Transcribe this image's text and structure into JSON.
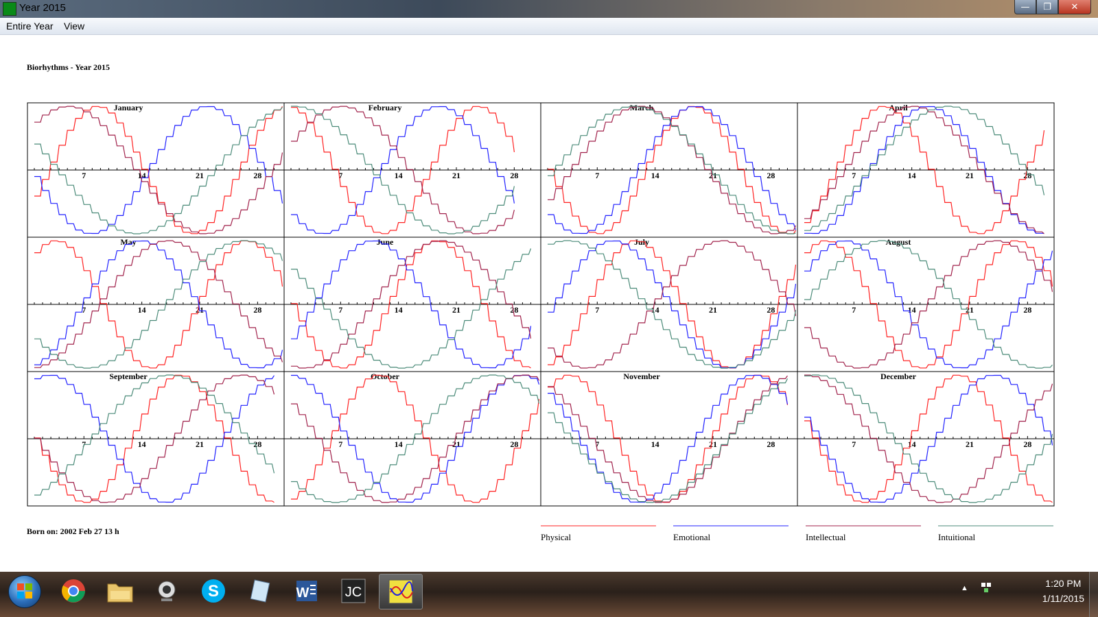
{
  "window": {
    "title": "Year 2015"
  },
  "menu": {
    "items": [
      "Entire Year",
      "View"
    ]
  },
  "page": {
    "heading": "Biorhythms - Year 2015",
    "born": "Born on: 2002 Feb 27  13 h"
  },
  "colors": {
    "physical": "#ff2020",
    "emotional": "#2020ff",
    "intellectual": "#a0204a",
    "intuitional": "#4a8a78"
  },
  "chart_data": {
    "type": "line",
    "title": "Biorhythms - Year 2015",
    "year": 2015,
    "months": [
      {
        "name": "January",
        "days": 31
      },
      {
        "name": "February",
        "days": 28
      },
      {
        "name": "March",
        "days": 31
      },
      {
        "name": "April",
        "days": 30
      },
      {
        "name": "May",
        "days": 31
      },
      {
        "name": "June",
        "days": 30
      },
      {
        "name": "July",
        "days": 31
      },
      {
        "name": "August",
        "days": 31
      },
      {
        "name": "September",
        "days": 30
      },
      {
        "name": "October",
        "days": 31
      },
      {
        "name": "November",
        "days": 30
      },
      {
        "name": "December",
        "days": 31
      }
    ],
    "x_tick_labels": [
      "7",
      "14",
      "21",
      "28"
    ],
    "ylim": [
      -1,
      1
    ],
    "birth": "2002-02-27 13:00",
    "series": [
      {
        "name": "Physical",
        "period_days": 23,
        "color": "#ff2020"
      },
      {
        "name": "Emotional",
        "period_days": 28,
        "color": "#2020ff"
      },
      {
        "name": "Intellectual",
        "period_days": 33,
        "color": "#a0204a"
      },
      {
        "name": "Intuitional",
        "period_days": 38,
        "color": "#4a8a78"
      }
    ]
  },
  "taskbar": {
    "apps": [
      "start-button",
      "chrome",
      "file-explorer",
      "webcam",
      "skype",
      "notepad",
      "word",
      "jc",
      "biorhythm"
    ],
    "time": "1:20 PM",
    "date": "1/11/2015"
  }
}
